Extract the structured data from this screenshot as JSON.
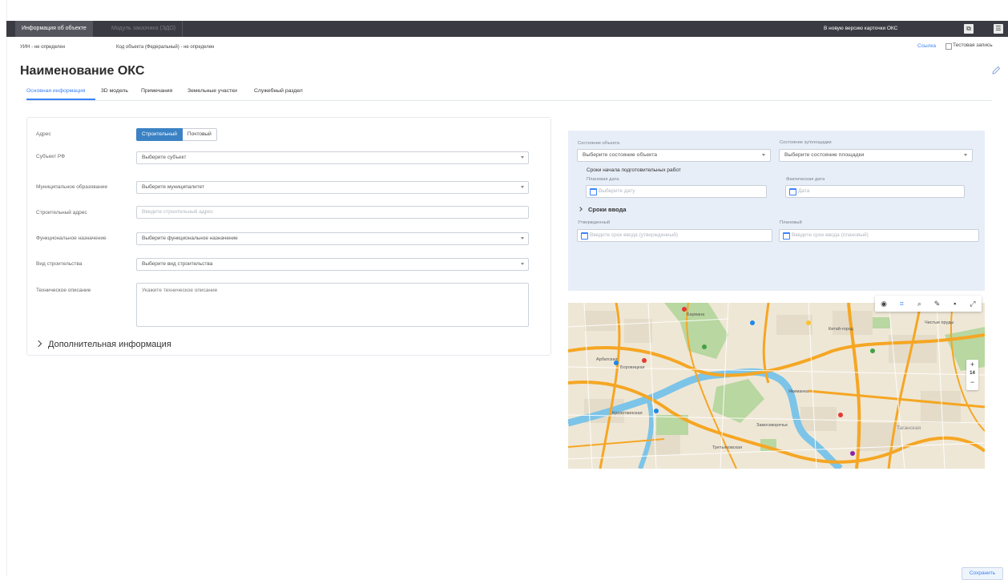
{
  "topbar": {
    "tabs": [
      {
        "label": "Информация об объекте",
        "active": true
      },
      {
        "label": "Модуль заказчика (ЭДО)",
        "active": false
      }
    ],
    "new_version_link": "В новую версию карточки ОКС",
    "icons": [
      "copy-icon",
      "document-icon"
    ]
  },
  "meta": {
    "uin": "УИН - не определен",
    "object_code": "Код объекта (Федеральный) - не определен",
    "link": "Ссылка",
    "test_record_label": "Тестовая запись"
  },
  "page": {
    "title": "Наименование ОКС"
  },
  "tabs": [
    {
      "label": "Основная информация",
      "active": true
    },
    {
      "label": "3D модель"
    },
    {
      "label": "Примечания"
    },
    {
      "label": "Земельные участки"
    },
    {
      "label": "Служебный раздел"
    }
  ],
  "form": {
    "address": {
      "label": "Адрес",
      "options": [
        "Строительный",
        "Почтовый"
      ],
      "selected": "Строительный"
    },
    "subject": {
      "label": "Субъект РФ",
      "placeholder": "Выберите субъект"
    },
    "municipality": {
      "label": "Муниципальное образование",
      "placeholder": "Выберите муниципалитет"
    },
    "construction_address": {
      "label": "Строительный адрес",
      "placeholder": "Введите строительный адрес"
    },
    "function": {
      "label": "Функциональное назначение",
      "placeholder": "Выберите функциональное назначение"
    },
    "construction_type": {
      "label": "Вид строительства",
      "placeholder": "Выберите вид строительства"
    },
    "tech_description": {
      "label": "Техническое описание",
      "placeholder": "Укажите техническое описание"
    },
    "more_info": "Дополнительная информация"
  },
  "status_panel": {
    "object_state_label": "Состояние объекта",
    "object_state_placeholder": "Выберите состояние объекта",
    "site_state_label": "Состояние зу/площадки",
    "site_state_placeholder": "Выберите состояние площадки",
    "prep_work_title": "Сроки начала подготовительных работ",
    "planned_date_label": "Плановая дата",
    "planned_date_placeholder": "Выберите дату",
    "actual_date_label": "Фактическая дата",
    "actual_date_placeholder": "Дата",
    "commissioning_title": "Сроки ввода",
    "approved_label": "Утвержденный",
    "approved_placeholder": "Введите срок ввода (утвержденный)",
    "planned_label": "Плановый",
    "planned_placeholder": "Введите срок ввода (плановый)"
  },
  "map": {
    "zoom_level": "14",
    "zoom_in": "+",
    "zoom_out": "−",
    "labels": [
      "Китай-город",
      "Чистые пруды",
      "Якиманка",
      "Арбатская",
      "Кропоткинская",
      "Третьяковская",
      "Таганская",
      "Боровицкая",
      "Баумана",
      "Замоскворечье"
    ],
    "toolbar_icons": [
      "layers-icon",
      "select-area-icon",
      "search-icon",
      "pencil-icon",
      "trash-icon",
      "expand-icon"
    ]
  },
  "footer": {
    "save_label": "Сохранить"
  },
  "colors": {
    "accent": "#3b82f6",
    "topbar": "#3a3a42",
    "panel": "#e8eef8"
  }
}
